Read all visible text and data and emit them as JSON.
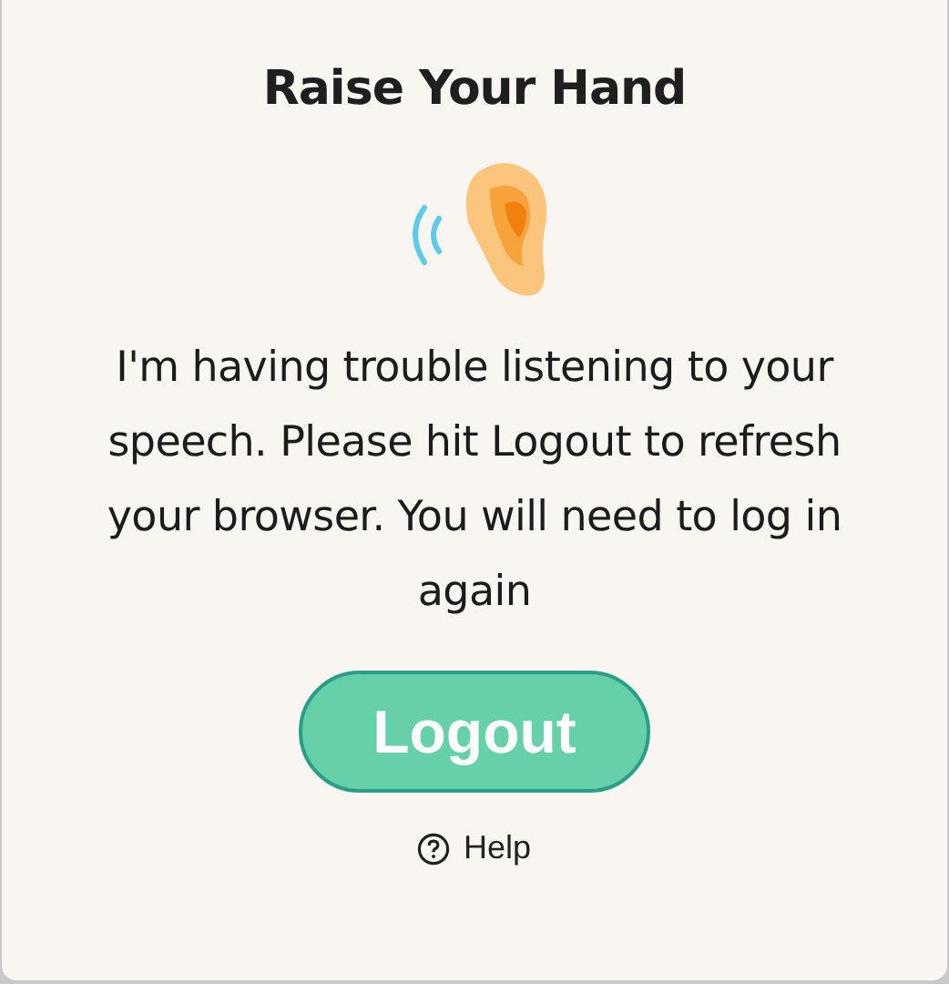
{
  "dialog": {
    "title": "Raise Your Hand",
    "message": "I'm having trouble listening to your speech. Please hit Logout to refresh your browser. You will need to log in again",
    "button": "Logout",
    "help": "Help"
  }
}
